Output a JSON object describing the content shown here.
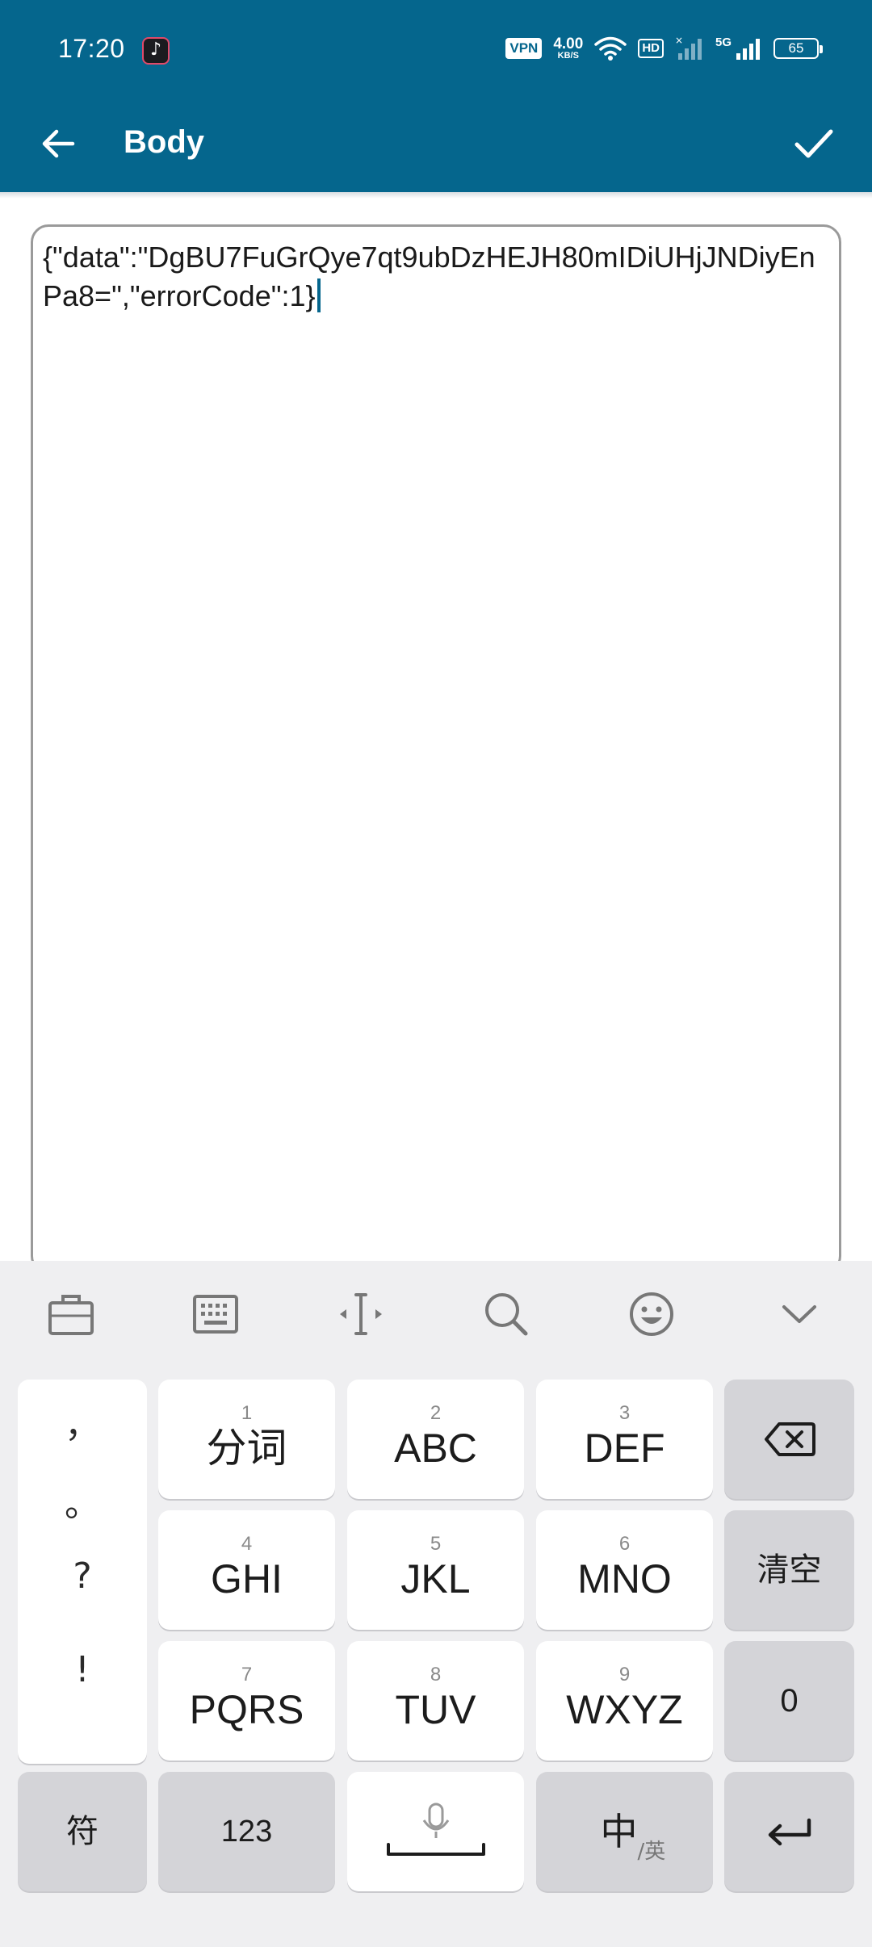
{
  "status_bar": {
    "time": "17:20",
    "vpn": "VPN",
    "net_speed": "4.00",
    "net_speed_unit": "KB/S",
    "hd": "HD",
    "network": "5G",
    "battery": "65"
  },
  "app_bar": {
    "title": "Body"
  },
  "editor": {
    "content": "{\"data\":\"DgBU7FuGrQye7qt9ubDzHEJH80mIDiUHjJNDiyEnPa8=\",\"errorCode\":1}"
  },
  "keyboard": {
    "toolbar_icons": [
      "clipboard-icon",
      "keyboard-icon",
      "cursor-icon",
      "search-icon",
      "emoji-icon",
      "collapse-icon"
    ],
    "punctuation": [
      "，",
      "。",
      "?",
      "!"
    ],
    "keys": {
      "k1": {
        "num": "1",
        "label": "分词"
      },
      "k2": {
        "num": "2",
        "label": "ABC"
      },
      "k3": {
        "num": "3",
        "label": "DEF"
      },
      "k4": {
        "num": "4",
        "label": "GHI"
      },
      "k5": {
        "num": "5",
        "label": "JKL"
      },
      "k6": {
        "num": "6",
        "label": "MNO"
      },
      "k7": {
        "num": "7",
        "label": "PQRS"
      },
      "k8": {
        "num": "8",
        "label": "TUV"
      },
      "k9": {
        "num": "9",
        "label": "WXYZ"
      },
      "clear": "清空",
      "zero": "0",
      "symbols": "符",
      "num123": "123",
      "lang_main": "中",
      "lang_sub": "/英"
    }
  },
  "colors": {
    "primary": "#05668d",
    "keyboard_bg": "#efeff1",
    "key_dark": "#d4d4d8",
    "key_light": "#ffffff"
  }
}
